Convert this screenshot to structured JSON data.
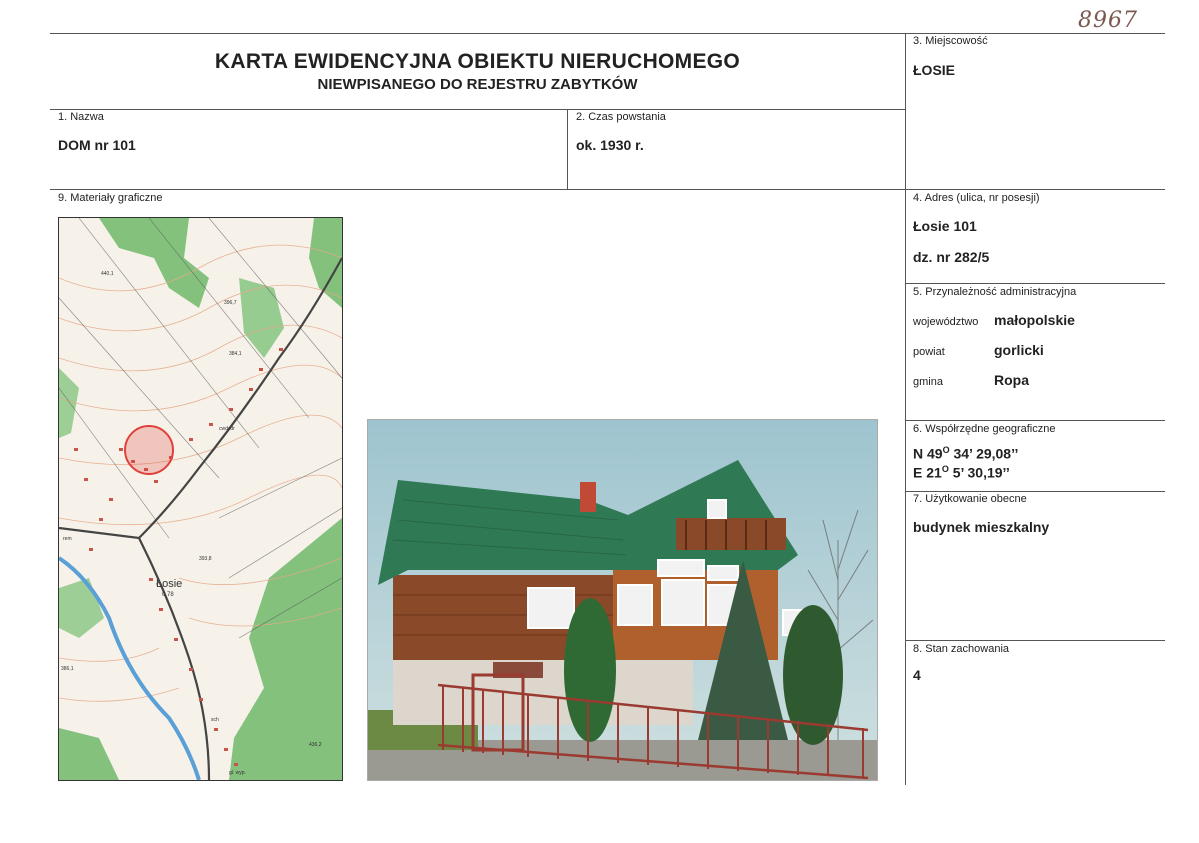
{
  "header": {
    "archive_number": "8967",
    "title": "KARTA EWIDENCYJNA OBIEKTU NIERUCHOMEGO",
    "subtitle": "NIEWPISANEGO DO REJESTRU ZABYTKÓW"
  },
  "fields": {
    "name": {
      "label": "1. Nazwa",
      "value": "DOM nr 101"
    },
    "date": {
      "label": "2. Czas powstania",
      "value": "ok. 1930 r."
    },
    "locality": {
      "label": "3. Miejscowość",
      "value": "ŁOSIE"
    },
    "address": {
      "label": "4. Adres (ulica, nr posesji)",
      "line1": "Łosie 101",
      "line2": "dz. nr 282/5"
    },
    "admin": {
      "label": "5. Przynależność administracyjna",
      "voivodeship_label": "województwo",
      "voivodeship": "małopolskie",
      "county_label": "powiat",
      "county": "gorlicki",
      "commune_label": "gmina",
      "commune": "Ropa"
    },
    "coords": {
      "label": "6. Współrzędne geograficzne",
      "n_prefix": "N 49",
      "n_deg": "O",
      "n_rest": " 34’ 29,08’’",
      "e_prefix": "E 21",
      "e_deg": "O",
      "e_rest": " 5’ 30,19’’"
    },
    "usage": {
      "label": "7. Użytkowanie obecne",
      "value": "budynek mieszkalny"
    },
    "condition": {
      "label": "8. Stan zachowania",
      "value": "4"
    },
    "graphics": {
      "label": "9. Materiały graficzne"
    }
  },
  "map": {
    "town_label": "Łosie",
    "town_sub": "0,78",
    "spot_heights": [
      "440,1",
      "396,7",
      "384,1",
      "393,8",
      "386,1",
      "436,2"
    ],
    "small_labels": [
      "cwdzdr",
      "rem",
      "sch",
      "gl. wyp."
    ]
  },
  "colors": {
    "map_forest": "#6fb86a",
    "map_contour": "#e7a98a",
    "marker": "#e0403a",
    "roof": "#2f7a55",
    "wood": "#8a4a2a",
    "fence": "#9a3a30"
  }
}
